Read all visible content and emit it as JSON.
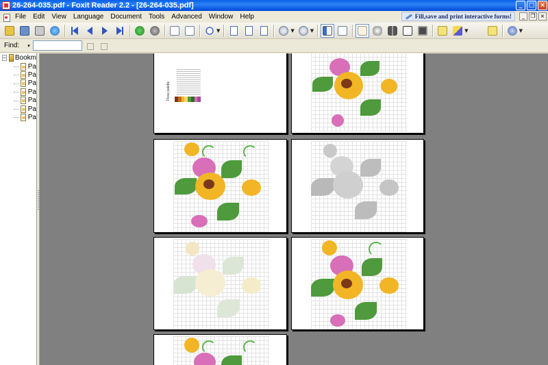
{
  "window": {
    "title": "26-264-035.pdf - Foxit Reader 2.2 - [26-264-035.pdf]",
    "minimize": "_",
    "maximize": "□",
    "close": "×"
  },
  "menu": {
    "items": [
      "File",
      "Edit",
      "View",
      "Language",
      "Document",
      "Tools",
      "Advanced",
      "Window",
      "Help"
    ],
    "promo": "Fill,save and print interactive forms!",
    "mdi_min": "_",
    "mdi_restore": "❐",
    "mdi_close": "×"
  },
  "toolbar": {
    "icons": [
      "open-icon",
      "save-icon",
      "print-icon",
      "web-icon",
      "first-page-icon",
      "previous-page-icon",
      "next-page-icon",
      "last-page-icon",
      "go-forward-icon",
      "go-back-icon",
      "rotate-left-icon",
      "rotate-right-icon",
      "zoom-icon",
      "actual-size-icon",
      "fit-page-icon",
      "fit-width-icon",
      "zoom-out-icon",
      "zoom-in-icon",
      "bookmarks-icon",
      "thumbnails-icon",
      "hand-tool-icon",
      "magnifier-icon",
      "find-icon",
      "select-text-icon",
      "snapshot-icon",
      "annotation-icon",
      "highlight-icon",
      "typewriter-icon",
      "note-icon",
      "info-icon"
    ]
  },
  "find": {
    "label": "Find:",
    "caret": "▾",
    "value": ""
  },
  "bookmarks": {
    "root_label": "Bookm",
    "expander": "−",
    "items": [
      "Pa",
      "Pa",
      "Pa",
      "Pa",
      "Pa",
      "Pa",
      "Pa"
    ]
  },
  "palette_page": {
    "heading": "Floss palette"
  },
  "colors": {
    "title_bar": "#0A5FE6",
    "doc_background": "#808080",
    "leaf": "#4e9a3c",
    "petal_yellow": "#f2b526",
    "petal_pink": "#d86fb8"
  }
}
